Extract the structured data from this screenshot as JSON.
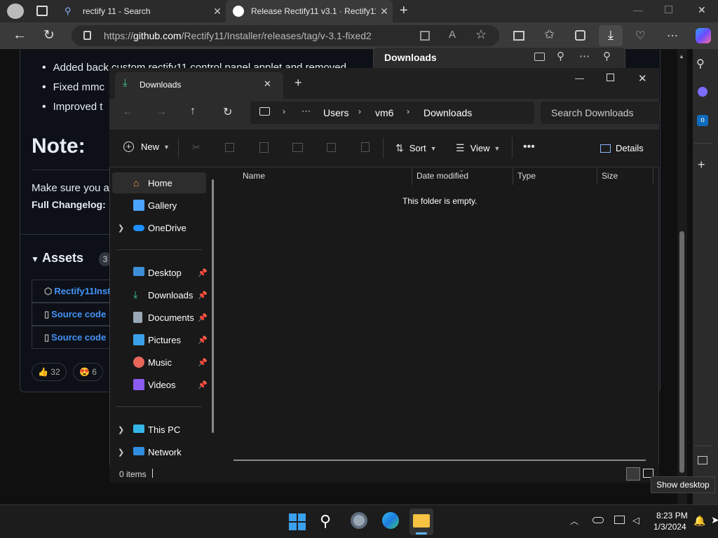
{
  "browser": {
    "tabs": [
      {
        "title": "rectify 11 - Search"
      },
      {
        "title": "Release Rectify11 v3.1 · Rectify11"
      }
    ],
    "url_prefix": "https://",
    "url_host": "github.com",
    "url_path": "/Rectify11/Installer/releases/tag/v-3.1-fixed2"
  },
  "page": {
    "bullets": [
      "Added back custom rectify11 control panel applet and removed",
      "Fixed mmc",
      "Improved t"
    ],
    "note_title": "Note:",
    "make_sure": "Make sure you a",
    "full_changelog": "Full Changelog:",
    "assets_title": "Assets",
    "assets_count": "3",
    "assets": [
      "Rectify11Inst",
      "Source code",
      "Source code"
    ],
    "reactions": [
      {
        "emoji": "👍",
        "count": "32"
      },
      {
        "emoji": "😍",
        "count": "6"
      }
    ]
  },
  "downloads_flyout": {
    "title": "Downloads"
  },
  "explorer": {
    "tab_title": "Downloads",
    "breadcrumb": [
      "Users",
      "vm6",
      "Downloads"
    ],
    "search_placeholder": "Search Downloads",
    "toolbar": {
      "new_label": "New",
      "sort_label": "Sort",
      "view_label": "View",
      "details_label": "Details"
    },
    "nav": {
      "top": [
        {
          "label": "Home",
          "icon": "home-icon"
        },
        {
          "label": "Gallery",
          "icon": "gallery-icon"
        },
        {
          "label": "OneDrive",
          "icon": "onedrive-icon"
        }
      ],
      "quick": [
        {
          "label": "Desktop",
          "icon": "desktop-icon"
        },
        {
          "label": "Downloads",
          "icon": "downloads-icon"
        },
        {
          "label": "Documents",
          "icon": "documents-icon"
        },
        {
          "label": "Pictures",
          "icon": "pictures-icon"
        },
        {
          "label": "Music",
          "icon": "music-icon"
        },
        {
          "label": "Videos",
          "icon": "videos-icon"
        }
      ],
      "bottom": [
        {
          "label": "This PC",
          "icon": "this-pc-icon"
        },
        {
          "label": "Network",
          "icon": "network-icon"
        }
      ]
    },
    "columns": [
      "Name",
      "Date modified",
      "Type",
      "Size"
    ],
    "empty_message": "This folder is empty.",
    "status": "0 items"
  },
  "taskbar": {
    "tooltip": "Show desktop",
    "time": "8:23 PM",
    "date": "1/3/2024"
  },
  "colors": {
    "accent": "#0078d4",
    "link": "#4493f8",
    "github_bg": "#0d1117"
  }
}
